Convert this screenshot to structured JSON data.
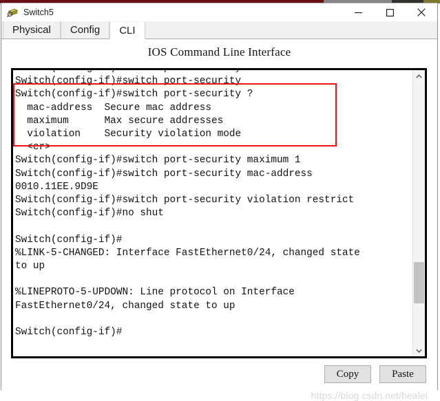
{
  "window": {
    "title": "Switch5",
    "icon": "switch-device-icon",
    "controls": {
      "minimize": "minimize-icon",
      "maximize": "maximize-icon",
      "close": "close-icon"
    }
  },
  "tabs": [
    {
      "label": "Physical",
      "active": false
    },
    {
      "label": "Config",
      "active": false
    },
    {
      "label": "CLI",
      "active": true
    }
  ],
  "heading": "IOS Command Line Interface",
  "terminal": {
    "lines": [
      "Switch(config-if)#switch port-security ?",
      "Switch(config-if)#switch port-security",
      "Switch(config-if)#switch port-security ?",
      "  mac-address  Secure mac address",
      "  maximum      Max secure addresses",
      "  violation    Security violation mode",
      "  <cr>",
      "Switch(config-if)#switch port-security maximum 1",
      "Switch(config-if)#switch port-security mac-address",
      "0010.11EE.9D9E",
      "Switch(config-if)#switch port-security violation restrict",
      "Switch(config-if)#no shut",
      "",
      "Switch(config-if)#",
      "%LINK-5-CHANGED: Interface FastEthernet0/24, changed state",
      "to up",
      "",
      "%LINEPROTO-5-UPDOWN: Line protocol on Interface",
      "FastEthernet0/24, changed state to up",
      "",
      "Switch(config-if)#"
    ],
    "highlight_color": "#ee1111"
  },
  "scrollbar": {
    "up_arrow": "chevron-up-icon",
    "down_arrow": "chevron-down-icon"
  },
  "buttons": {
    "copy": "Copy",
    "paste": "Paste"
  },
  "watermark": "https://blog.csdn.net/bealei"
}
